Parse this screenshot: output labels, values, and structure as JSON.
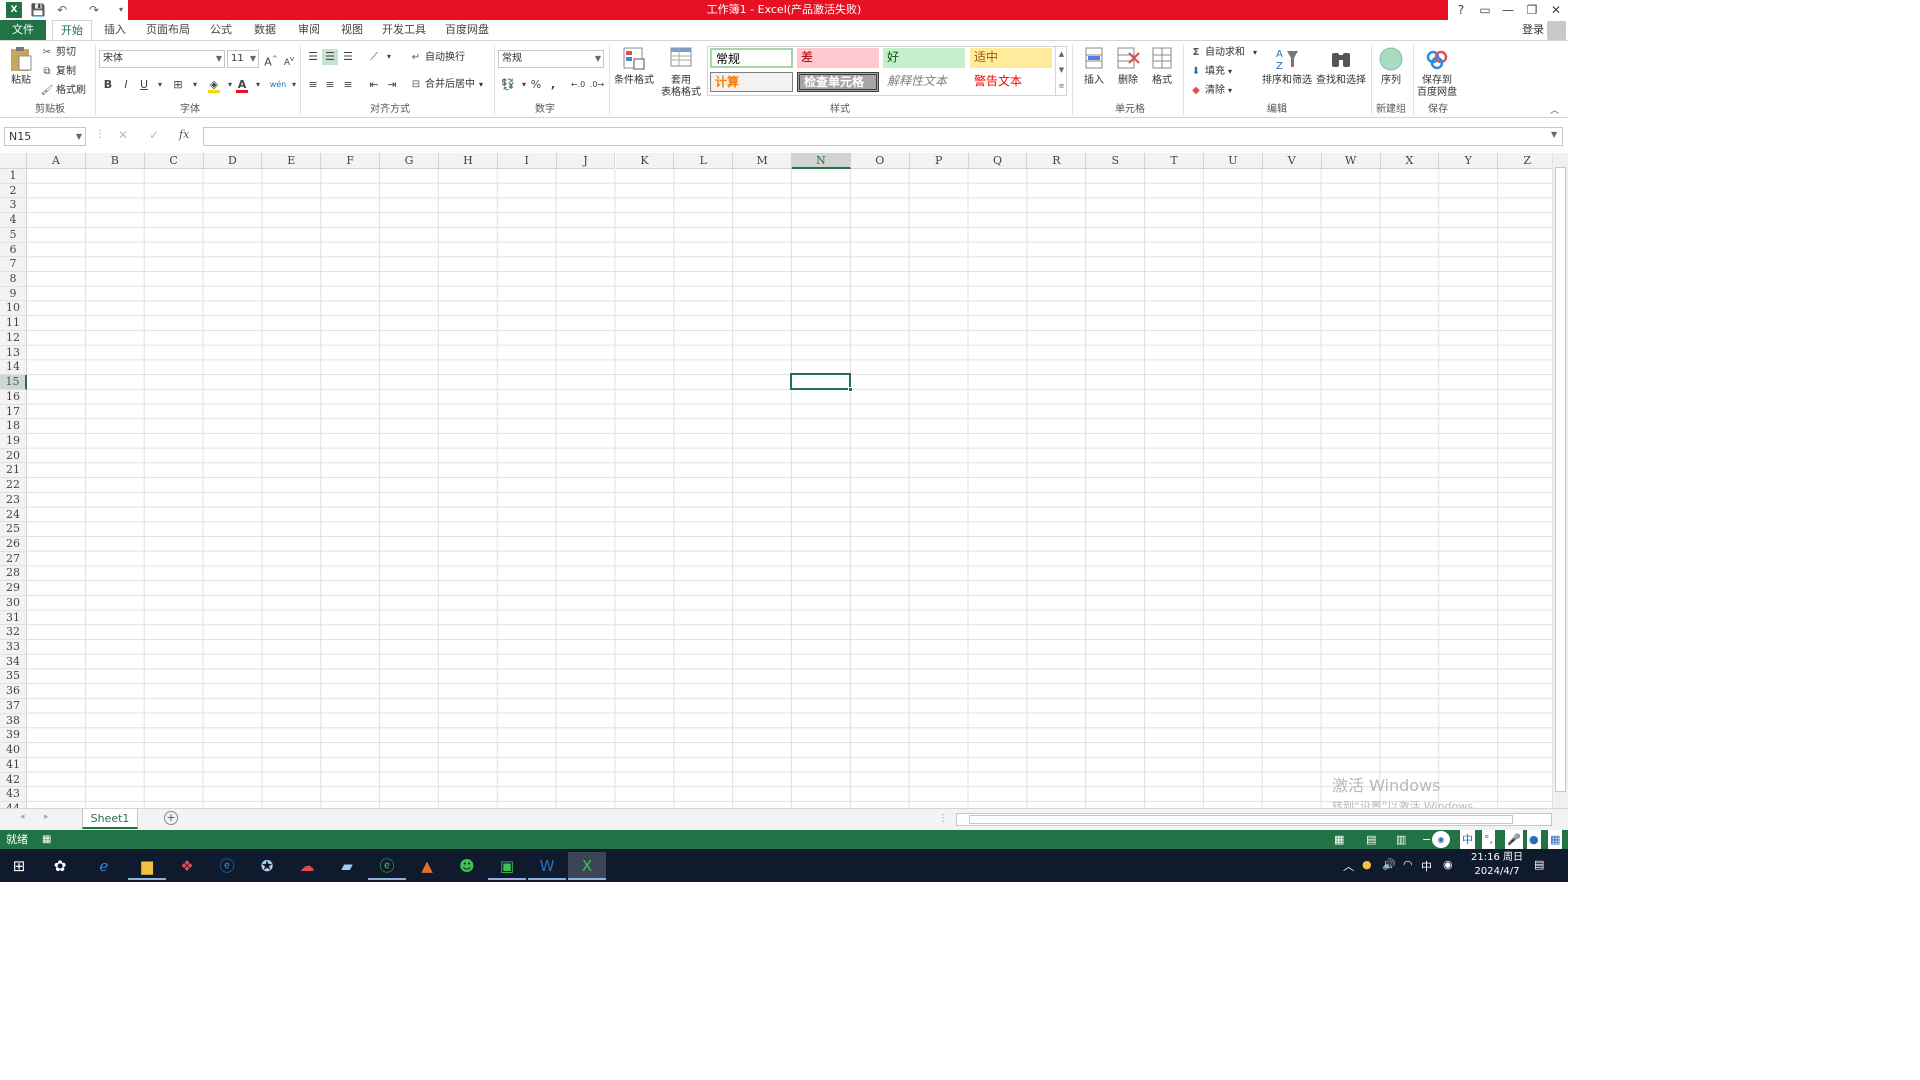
{
  "titlebar": {
    "title": "工作簿1 -   Excel(产品激活失败)",
    "help": "?",
    "minimize": "—",
    "restore": "❐",
    "close": "✕"
  },
  "tabs": [
    "文件",
    "开始",
    "插入",
    "页面布局",
    "公式",
    "数据",
    "审阅",
    "视图",
    "开发工具",
    "百度网盘"
  ],
  "login": "登录",
  "clipboard": {
    "paste": "粘贴",
    "cut": "剪切",
    "copy": "复制",
    "painter": "格式刷",
    "label": "剪贴板"
  },
  "font": {
    "name": "宋体",
    "size": "11",
    "bold": "B",
    "italic": "I",
    "underline": "U",
    "wen": "wén",
    "label": "字体",
    "fill_color": "#f5d800",
    "text_color": "#e81123"
  },
  "align": {
    "wrap": "自动换行",
    "merge": "合并后居中",
    "label": "对齐方式"
  },
  "number": {
    "format": "常规",
    "percent": "%",
    "comma": ",",
    "label": "数字"
  },
  "styles_group": {
    "cond": "条件格式",
    "table_line1": "套用",
    "table_line2": "表格格式",
    "label": "样式",
    "normal": "常规",
    "bad": "差",
    "good": "好",
    "neutral": "适中",
    "calc": "计算",
    "check": "检查单元格",
    "explain": "解释性文本",
    "warn": "警告文本"
  },
  "cells_group": {
    "insert": "插入",
    "delete": "删除",
    "format": "格式",
    "label": "单元格"
  },
  "edit_group": {
    "autosum": "自动求和",
    "fill": "填充",
    "clear": "清除",
    "sort": "排序和筛选",
    "find": "查找和选择",
    "label": "编辑"
  },
  "newgroup": {
    "seq": "序列",
    "label": "新建组"
  },
  "save_group": {
    "line1": "保存到",
    "line2": "百度网盘",
    "label": "保存"
  },
  "formula": {
    "namebox": "N15",
    "fx": "fx",
    "cancel": "✕",
    "enter": "✓",
    "value": ""
  },
  "columns": [
    "A",
    "B",
    "C",
    "D",
    "E",
    "F",
    "G",
    "H",
    "I",
    "J",
    "K",
    "L",
    "M",
    "N",
    "O",
    "P",
    "Q",
    "R",
    "S",
    "T",
    "U",
    "V",
    "W",
    "X",
    "Y",
    "Z"
  ],
  "selected": {
    "col": "N",
    "row": 15
  },
  "row_count": 44,
  "sheet_tab": "Sheet1",
  "status": "就绪",
  "watermark": {
    "line1": "激活 Windows",
    "line2": "转到“设置”以激活 Windows。"
  },
  "clock": {
    "time": "21:16 周日",
    "date": "2024/4/7"
  },
  "ime": "中"
}
